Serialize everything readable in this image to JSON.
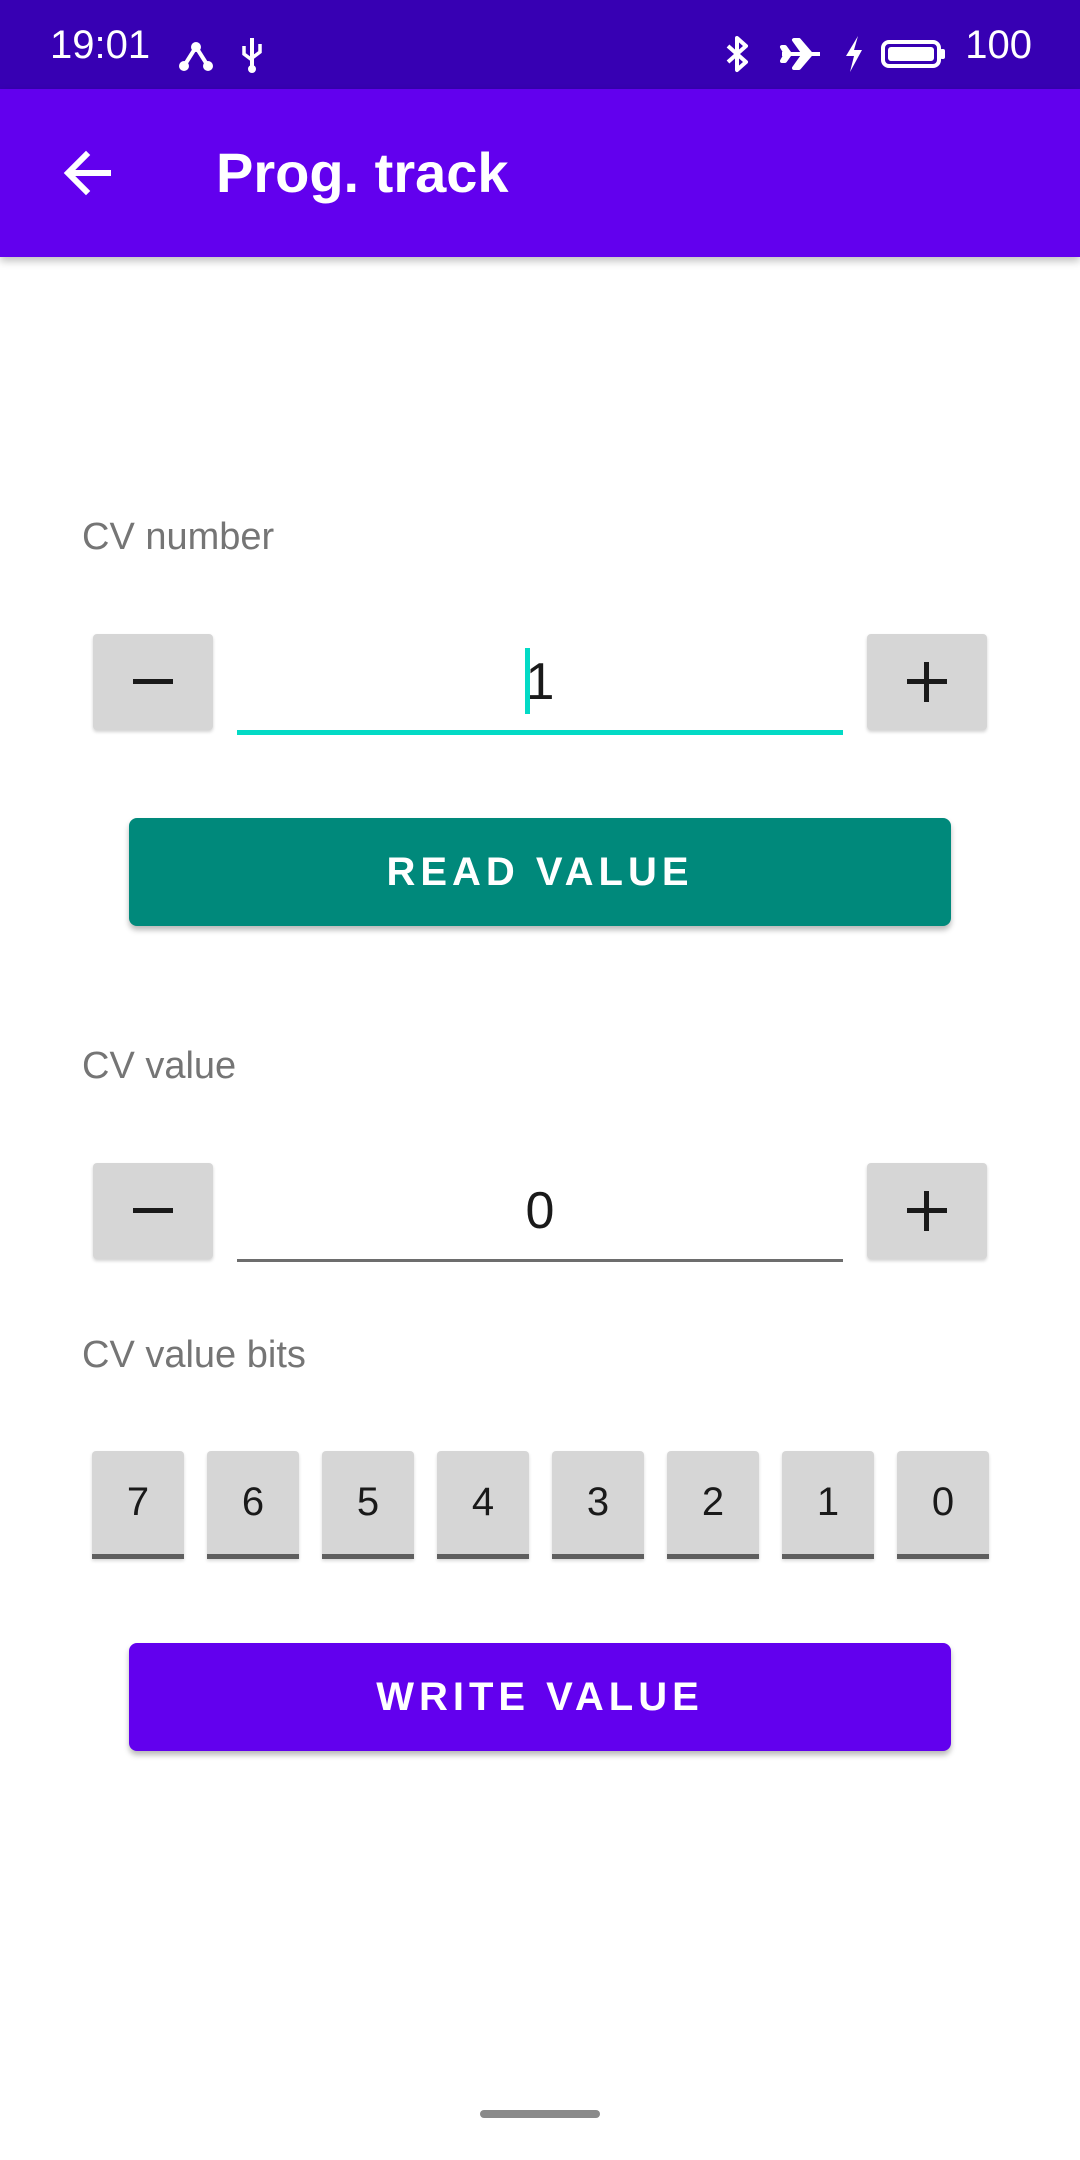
{
  "status_bar": {
    "time": "19:01",
    "battery": "100"
  },
  "app_bar": {
    "title": "Prog. track"
  },
  "cv_number": {
    "label": "CV number",
    "value": "1",
    "decrement": "−",
    "increment": "+"
  },
  "read_button": {
    "label": "READ VALUE"
  },
  "cv_value": {
    "label": "CV value",
    "value": "0",
    "decrement": "−",
    "increment": "+"
  },
  "cv_bits": {
    "label": "CV value bits",
    "bits": [
      "7",
      "6",
      "5",
      "4",
      "3",
      "2",
      "1",
      "0"
    ]
  },
  "write_button": {
    "label": "WRITE VALUE"
  },
  "colors": {
    "status_bar": "#3700b3",
    "app_bar": "#6200ee",
    "read_button": "#00897b",
    "write_button": "#6200ee",
    "focus_accent": "#03dac5"
  }
}
